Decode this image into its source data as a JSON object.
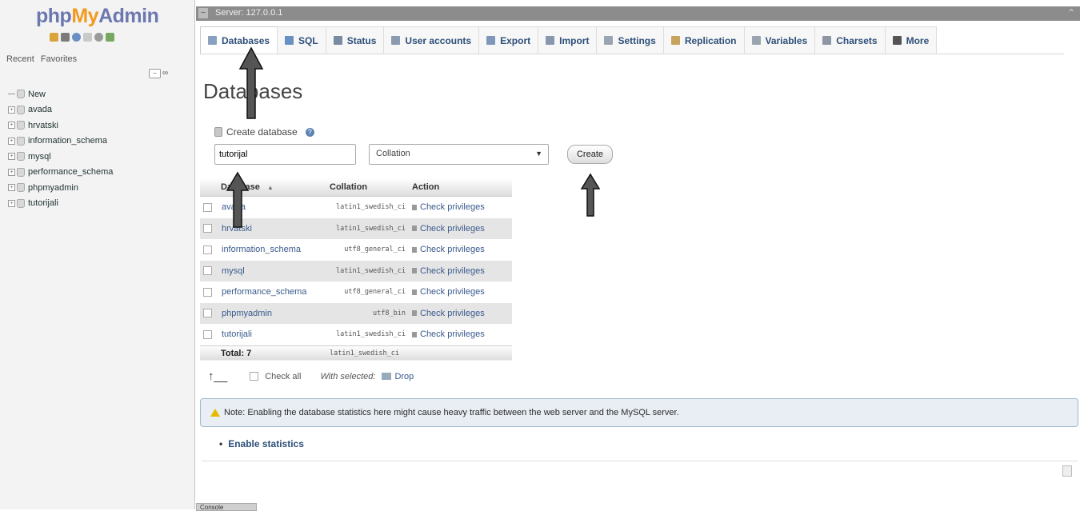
{
  "sidebar": {
    "logo_php": "php",
    "logo_my": "My",
    "logo_admin": "Admin",
    "tabs": [
      "Recent",
      "Favorites"
    ],
    "new_label": "New",
    "databases": [
      "avada",
      "hrvatski",
      "information_schema",
      "mysql",
      "performance_schema",
      "phpmyadmin",
      "tutorijali"
    ]
  },
  "serverbar": {
    "label": "Server: 127.0.0.1"
  },
  "tabs": [
    {
      "label": "Databases",
      "icon": "database-icon",
      "color": "#8aa0c0"
    },
    {
      "label": "SQL",
      "icon": "sql-icon",
      "color": "#6a8fc5"
    },
    {
      "label": "Status",
      "icon": "status-icon",
      "color": "#7a8aa0"
    },
    {
      "label": "User accounts",
      "icon": "user-accounts-icon",
      "color": "#8a9bb0"
    },
    {
      "label": "Export",
      "icon": "export-icon",
      "color": "#7f97b8"
    },
    {
      "label": "Import",
      "icon": "import-icon",
      "color": "#8797ad"
    },
    {
      "label": "Settings",
      "icon": "wrench-icon",
      "color": "#9aa5b2"
    },
    {
      "label": "Replication",
      "icon": "replication-icon",
      "color": "#c7a45c"
    },
    {
      "label": "Variables",
      "icon": "variables-icon",
      "color": "#9aa4b0"
    },
    {
      "label": "Charsets",
      "icon": "charsets-icon",
      "color": "#8d96a2"
    },
    {
      "label": "More",
      "icon": "chevron-down-icon",
      "color": "#555555"
    }
  ],
  "page": {
    "title": "Databases"
  },
  "create": {
    "legend": "Create database",
    "name_value": "tutorijal",
    "collation_value": "Collation",
    "button_label": "Create"
  },
  "table": {
    "headers": [
      "Database",
      "Collation",
      "Action"
    ],
    "sort_indicator": "▲",
    "rows": [
      {
        "name": "avada",
        "collation": "latin1_swedish_ci",
        "action": "Check privileges"
      },
      {
        "name": "hrvatski",
        "collation": "latin1_swedish_ci",
        "action": "Check privileges"
      },
      {
        "name": "information_schema",
        "collation": "utf8_general_ci",
        "action": "Check privileges"
      },
      {
        "name": "mysql",
        "collation": "latin1_swedish_ci",
        "action": "Check privileges"
      },
      {
        "name": "performance_schema",
        "collation": "utf8_general_ci",
        "action": "Check privileges"
      },
      {
        "name": "phpmyadmin",
        "collation": "utf8_bin",
        "action": "Check privileges"
      },
      {
        "name": "tutorijali",
        "collation": "latin1_swedish_ci",
        "action": "Check privileges"
      }
    ],
    "total_label": "Total: 7",
    "total_collation": "latin1_swedish_ci"
  },
  "with_selected": {
    "check_all": "Check all",
    "label": "With selected:",
    "drop": "Drop"
  },
  "notice": {
    "text": "Note: Enabling the database statistics here might cause heavy traffic between the web server and the MySQL server."
  },
  "enable_stats": "Enable statistics",
  "console": "Console"
}
